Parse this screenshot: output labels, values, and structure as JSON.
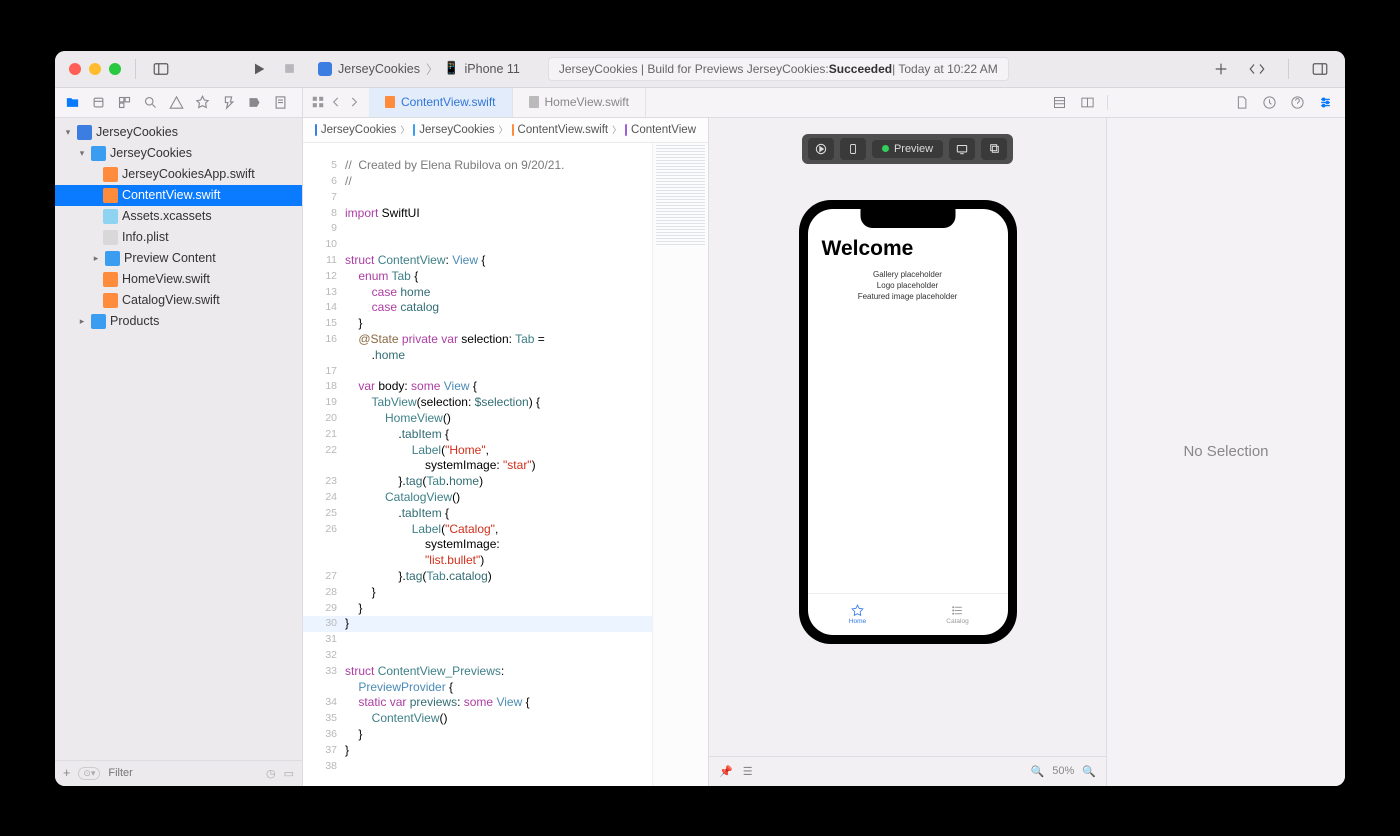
{
  "window": {
    "close": "",
    "min": "",
    "max": ""
  },
  "scheme": {
    "project": "JerseyCookies",
    "device": "iPhone 11"
  },
  "status": {
    "prefix": "JerseyCookies | Build for Previews JerseyCookies: ",
    "result": "Succeeded",
    "suffix": " | Today at 10:22 AM"
  },
  "tabs": {
    "active": "ContentView.swift",
    "other": "HomeView.swift"
  },
  "breadcrumb": {
    "p0": "JerseyCookies",
    "p1": "JerseyCookies",
    "p2": "ContentView.swift",
    "p3": "ContentView"
  },
  "tree": {
    "root": "JerseyCookies",
    "folder": "JerseyCookies",
    "f0": "JerseyCookiesApp.swift",
    "f1": "ContentView.swift",
    "f2": "Assets.xcassets",
    "f3": "Info.plist",
    "f4": "Preview Content",
    "f5": "HomeView.swift",
    "f6": "CatalogView.swift",
    "products": "Products",
    "filter_placeholder": "Filter"
  },
  "code": {
    "lines": [
      {
        "n": "",
        "html": ""
      },
      {
        "n": "5",
        "html": "<span class='cmt'>//  Created by Elena Rubilova on 9/20/21.</span>"
      },
      {
        "n": "6",
        "html": "<span class='cmt'>//</span>"
      },
      {
        "n": "7",
        "html": ""
      },
      {
        "n": "8",
        "html": "<span class='kw'>import</span> SwiftUI"
      },
      {
        "n": "9",
        "html": ""
      },
      {
        "n": "10",
        "html": ""
      },
      {
        "n": "11",
        "html": "<span class='kw'>struct</span> <span class='type'>ContentView</span>: <span class='typekw'>View</span> {"
      },
      {
        "n": "12",
        "html": "    <span class='kw'>enum</span> <span class='type'>Tab</span> {"
      },
      {
        "n": "13",
        "html": "        <span class='kw'>case</span> <span class='prop'>home</span>"
      },
      {
        "n": "14",
        "html": "        <span class='kw'>case</span> <span class='prop'>catalog</span>"
      },
      {
        "n": "15",
        "html": "    }"
      },
      {
        "n": "16",
        "html": "    <span class='attr'>@State</span> <span class='kw'>private</span> <span class='kw'>var</span> selection: <span class='type'>Tab</span> ="
      },
      {
        "n": "",
        "html": "        .<span class='prop'>home</span>"
      },
      {
        "n": "17",
        "html": ""
      },
      {
        "n": "18",
        "html": "    <span class='kw'>var</span> body: <span class='kw'>some</span> <span class='typekw'>View</span> {"
      },
      {
        "n": "19",
        "html": "        <span class='type'>TabView</span>(selection: <span class='call'>$selection</span>) {"
      },
      {
        "n": "20",
        "html": "            <span class='type'>HomeView</span>()"
      },
      {
        "n": "21",
        "html": "                .<span class='call'>tabItem</span> {"
      },
      {
        "n": "22",
        "html": "                    <span class='type'>Label</span>(<span class='str'>\"Home\"</span>,"
      },
      {
        "n": "",
        "html": "                        systemImage: <span class='str'>\"star\"</span>)"
      },
      {
        "n": "23",
        "html": "                }.<span class='call'>tag</span>(<span class='type'>Tab</span>.<span class='prop'>home</span>)"
      },
      {
        "n": "24",
        "html": "            <span class='type'>CatalogView</span>()"
      },
      {
        "n": "25",
        "html": "                .<span class='call'>tabItem</span> {"
      },
      {
        "n": "26",
        "html": "                    <span class='type'>Label</span>(<span class='str'>\"Catalog\"</span>,"
      },
      {
        "n": "",
        "html": "                        systemImage:"
      },
      {
        "n": "",
        "html": "                        <span class='str'>\"list.bullet\"</span>)"
      },
      {
        "n": "27",
        "html": "                }.<span class='call'>tag</span>(<span class='type'>Tab</span>.<span class='prop'>catalog</span>)"
      },
      {
        "n": "28",
        "html": "        }"
      },
      {
        "n": "29",
        "html": "    }"
      },
      {
        "n": "30",
        "html": "}",
        "hl": true
      },
      {
        "n": "31",
        "html": ""
      },
      {
        "n": "32",
        "html": ""
      },
      {
        "n": "33",
        "html": "<span class='kw'>struct</span> <span class='type'>ContentView_Previews</span>:"
      },
      {
        "n": "",
        "html": "    <span class='typekw'>PreviewProvider</span> {"
      },
      {
        "n": "34",
        "html": "    <span class='kw'>static</span> <span class='kw'>var</span> <span class='prop'>previews</span>: <span class='kw'>some</span> <span class='typekw'>View</span> {"
      },
      {
        "n": "35",
        "html": "        <span class='type'>ContentView</span>()"
      },
      {
        "n": "36",
        "html": "    }"
      },
      {
        "n": "37",
        "html": "}"
      },
      {
        "n": "38",
        "html": ""
      }
    ]
  },
  "preview": {
    "label": "Preview",
    "welcome": "Welcome",
    "l1": "Gallery placeholder",
    "l2": "Logo placeholder",
    "l3": "Featured image placeholder",
    "tab_home": "Home",
    "tab_catalog": "Catalog",
    "zoom": "50%"
  },
  "inspector": {
    "empty": "No Selection"
  }
}
